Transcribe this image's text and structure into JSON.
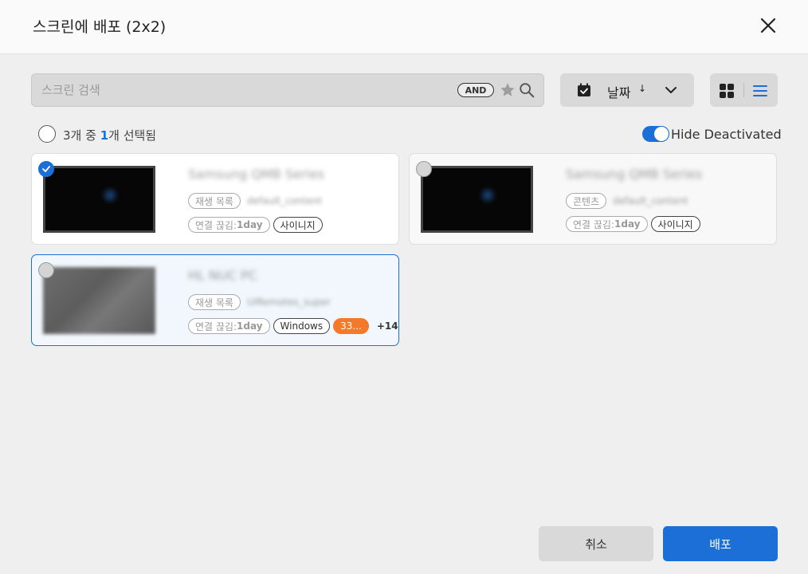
{
  "header": {
    "title": "스크린에 배포 (2x2)"
  },
  "search": {
    "placeholder": "스크린 검색",
    "and_label": "AND"
  },
  "sort": {
    "label": "날짜",
    "arrow": "↓"
  },
  "selection": {
    "prefix": "3개 중 ",
    "selected": "1",
    "suffix": "개 선택됨"
  },
  "toggle": {
    "label": "Hide Deactivated",
    "on": true
  },
  "colors": {
    "accent": "#1b6fd6",
    "orange": "#f4792a"
  },
  "cards": [
    {
      "name": "Samsung QMB Series",
      "tag1": "재생 목록",
      "tag1_value": "default_content",
      "conn_label": "연결 끊김:",
      "conn_value": "1day",
      "tag2": "사이니지",
      "selected": true
    },
    {
      "name": "Samsung QMB Series",
      "tag1": "콘텐츠",
      "tag1_value": "default_content",
      "conn_label": "연결 끊김:",
      "conn_value": "1day",
      "tag2": "사이니지",
      "selected": false
    },
    {
      "name": "HL NUC PC",
      "tag1": "재생 목록",
      "tag1_value": "UIRemotes_super",
      "conn_label": "연결 끊김:",
      "conn_value": "1day",
      "tag2": "Windows",
      "tag3": "33...",
      "more": "+14",
      "selected": false
    }
  ],
  "buttons": {
    "cancel": "취소",
    "deploy": "배포"
  }
}
